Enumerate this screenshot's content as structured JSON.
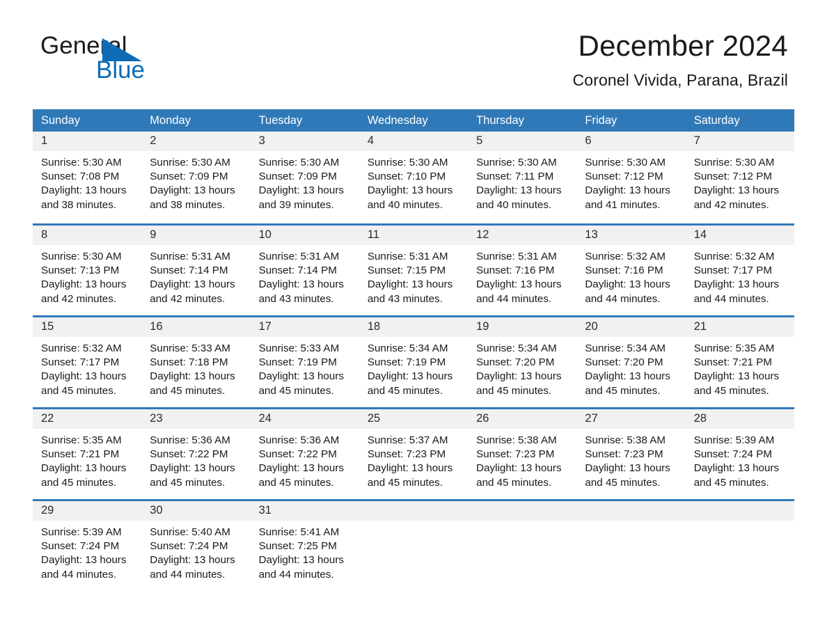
{
  "brand": {
    "word1": "General",
    "word2": "Blue",
    "triangle_color": "#0e6cb5",
    "text_color": "#1c1c1c"
  },
  "header": {
    "title": "December 2024",
    "location": "Coronel Vivida, Parana, Brazil"
  },
  "theme": {
    "header_blue": "#3079b8",
    "row_divider_blue": "#3079b8",
    "daynum_band": "#f1f1f1",
    "page_background": "#ffffff"
  },
  "calendar": {
    "weekday_headers": [
      "Sunday",
      "Monday",
      "Tuesday",
      "Wednesday",
      "Thursday",
      "Friday",
      "Saturday"
    ],
    "labels": {
      "sunrise": "Sunrise:",
      "sunset": "Sunset:",
      "daylight": "Daylight:"
    },
    "weeks": [
      [
        {
          "day": "1",
          "sunrise": "Sunrise: 5:30 AM",
          "sunset": "Sunset: 7:08 PM",
          "daylight_l1": "Daylight: 13 hours",
          "daylight_l2": "and 38 minutes."
        },
        {
          "day": "2",
          "sunrise": "Sunrise: 5:30 AM",
          "sunset": "Sunset: 7:09 PM",
          "daylight_l1": "Daylight: 13 hours",
          "daylight_l2": "and 38 minutes."
        },
        {
          "day": "3",
          "sunrise": "Sunrise: 5:30 AM",
          "sunset": "Sunset: 7:09 PM",
          "daylight_l1": "Daylight: 13 hours",
          "daylight_l2": "and 39 minutes."
        },
        {
          "day": "4",
          "sunrise": "Sunrise: 5:30 AM",
          "sunset": "Sunset: 7:10 PM",
          "daylight_l1": "Daylight: 13 hours",
          "daylight_l2": "and 40 minutes."
        },
        {
          "day": "5",
          "sunrise": "Sunrise: 5:30 AM",
          "sunset": "Sunset: 7:11 PM",
          "daylight_l1": "Daylight: 13 hours",
          "daylight_l2": "and 40 minutes."
        },
        {
          "day": "6",
          "sunrise": "Sunrise: 5:30 AM",
          "sunset": "Sunset: 7:12 PM",
          "daylight_l1": "Daylight: 13 hours",
          "daylight_l2": "and 41 minutes."
        },
        {
          "day": "7",
          "sunrise": "Sunrise: 5:30 AM",
          "sunset": "Sunset: 7:12 PM",
          "daylight_l1": "Daylight: 13 hours",
          "daylight_l2": "and 42 minutes."
        }
      ],
      [
        {
          "day": "8",
          "sunrise": "Sunrise: 5:30 AM",
          "sunset": "Sunset: 7:13 PM",
          "daylight_l1": "Daylight: 13 hours",
          "daylight_l2": "and 42 minutes."
        },
        {
          "day": "9",
          "sunrise": "Sunrise: 5:31 AM",
          "sunset": "Sunset: 7:14 PM",
          "daylight_l1": "Daylight: 13 hours",
          "daylight_l2": "and 42 minutes."
        },
        {
          "day": "10",
          "sunrise": "Sunrise: 5:31 AM",
          "sunset": "Sunset: 7:14 PM",
          "daylight_l1": "Daylight: 13 hours",
          "daylight_l2": "and 43 minutes."
        },
        {
          "day": "11",
          "sunrise": "Sunrise: 5:31 AM",
          "sunset": "Sunset: 7:15 PM",
          "daylight_l1": "Daylight: 13 hours",
          "daylight_l2": "and 43 minutes."
        },
        {
          "day": "12",
          "sunrise": "Sunrise: 5:31 AM",
          "sunset": "Sunset: 7:16 PM",
          "daylight_l1": "Daylight: 13 hours",
          "daylight_l2": "and 44 minutes."
        },
        {
          "day": "13",
          "sunrise": "Sunrise: 5:32 AM",
          "sunset": "Sunset: 7:16 PM",
          "daylight_l1": "Daylight: 13 hours",
          "daylight_l2": "and 44 minutes."
        },
        {
          "day": "14",
          "sunrise": "Sunrise: 5:32 AM",
          "sunset": "Sunset: 7:17 PM",
          "daylight_l1": "Daylight: 13 hours",
          "daylight_l2": "and 44 minutes."
        }
      ],
      [
        {
          "day": "15",
          "sunrise": "Sunrise: 5:32 AM",
          "sunset": "Sunset: 7:17 PM",
          "daylight_l1": "Daylight: 13 hours",
          "daylight_l2": "and 45 minutes."
        },
        {
          "day": "16",
          "sunrise": "Sunrise: 5:33 AM",
          "sunset": "Sunset: 7:18 PM",
          "daylight_l1": "Daylight: 13 hours",
          "daylight_l2": "and 45 minutes."
        },
        {
          "day": "17",
          "sunrise": "Sunrise: 5:33 AM",
          "sunset": "Sunset: 7:19 PM",
          "daylight_l1": "Daylight: 13 hours",
          "daylight_l2": "and 45 minutes."
        },
        {
          "day": "18",
          "sunrise": "Sunrise: 5:34 AM",
          "sunset": "Sunset: 7:19 PM",
          "daylight_l1": "Daylight: 13 hours",
          "daylight_l2": "and 45 minutes."
        },
        {
          "day": "19",
          "sunrise": "Sunrise: 5:34 AM",
          "sunset": "Sunset: 7:20 PM",
          "daylight_l1": "Daylight: 13 hours",
          "daylight_l2": "and 45 minutes."
        },
        {
          "day": "20",
          "sunrise": "Sunrise: 5:34 AM",
          "sunset": "Sunset: 7:20 PM",
          "daylight_l1": "Daylight: 13 hours",
          "daylight_l2": "and 45 minutes."
        },
        {
          "day": "21",
          "sunrise": "Sunrise: 5:35 AM",
          "sunset": "Sunset: 7:21 PM",
          "daylight_l1": "Daylight: 13 hours",
          "daylight_l2": "and 45 minutes."
        }
      ],
      [
        {
          "day": "22",
          "sunrise": "Sunrise: 5:35 AM",
          "sunset": "Sunset: 7:21 PM",
          "daylight_l1": "Daylight: 13 hours",
          "daylight_l2": "and 45 minutes."
        },
        {
          "day": "23",
          "sunrise": "Sunrise: 5:36 AM",
          "sunset": "Sunset: 7:22 PM",
          "daylight_l1": "Daylight: 13 hours",
          "daylight_l2": "and 45 minutes."
        },
        {
          "day": "24",
          "sunrise": "Sunrise: 5:36 AM",
          "sunset": "Sunset: 7:22 PM",
          "daylight_l1": "Daylight: 13 hours",
          "daylight_l2": "and 45 minutes."
        },
        {
          "day": "25",
          "sunrise": "Sunrise: 5:37 AM",
          "sunset": "Sunset: 7:23 PM",
          "daylight_l1": "Daylight: 13 hours",
          "daylight_l2": "and 45 minutes."
        },
        {
          "day": "26",
          "sunrise": "Sunrise: 5:38 AM",
          "sunset": "Sunset: 7:23 PM",
          "daylight_l1": "Daylight: 13 hours",
          "daylight_l2": "and 45 minutes."
        },
        {
          "day": "27",
          "sunrise": "Sunrise: 5:38 AM",
          "sunset": "Sunset: 7:23 PM",
          "daylight_l1": "Daylight: 13 hours",
          "daylight_l2": "and 45 minutes."
        },
        {
          "day": "28",
          "sunrise": "Sunrise: 5:39 AM",
          "sunset": "Sunset: 7:24 PM",
          "daylight_l1": "Daylight: 13 hours",
          "daylight_l2": "and 45 minutes."
        }
      ],
      [
        {
          "day": "29",
          "sunrise": "Sunrise: 5:39 AM",
          "sunset": "Sunset: 7:24 PM",
          "daylight_l1": "Daylight: 13 hours",
          "daylight_l2": "and 44 minutes."
        },
        {
          "day": "30",
          "sunrise": "Sunrise: 5:40 AM",
          "sunset": "Sunset: 7:24 PM",
          "daylight_l1": "Daylight: 13 hours",
          "daylight_l2": "and 44 minutes."
        },
        {
          "day": "31",
          "sunrise": "Sunrise: 5:41 AM",
          "sunset": "Sunset: 7:25 PM",
          "daylight_l1": "Daylight: 13 hours",
          "daylight_l2": "and 44 minutes."
        },
        {
          "day": "",
          "sunrise": "",
          "sunset": "",
          "daylight_l1": "",
          "daylight_l2": ""
        },
        {
          "day": "",
          "sunrise": "",
          "sunset": "",
          "daylight_l1": "",
          "daylight_l2": ""
        },
        {
          "day": "",
          "sunrise": "",
          "sunset": "",
          "daylight_l1": "",
          "daylight_l2": ""
        },
        {
          "day": "",
          "sunrise": "",
          "sunset": "",
          "daylight_l1": "",
          "daylight_l2": ""
        }
      ]
    ]
  }
}
